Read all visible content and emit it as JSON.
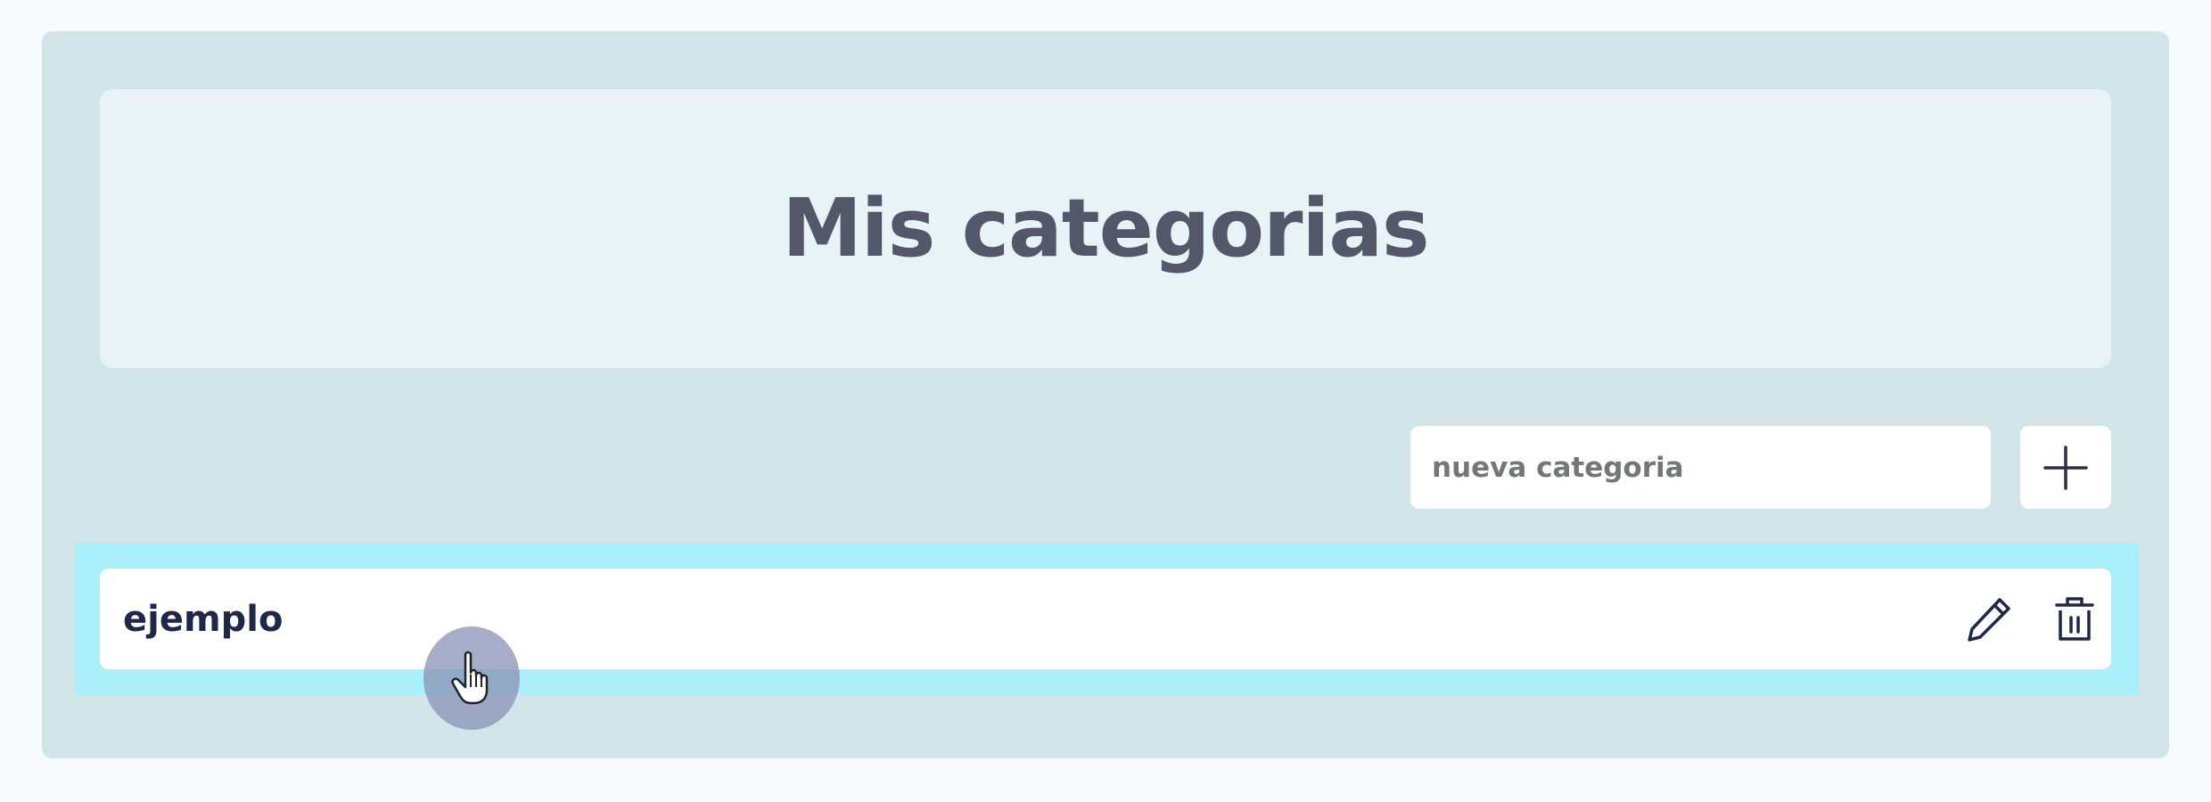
{
  "header": {
    "title": "Mis categorias"
  },
  "new_category": {
    "placeholder": "nueva categoria",
    "value": "",
    "add_icon": "plus-icon"
  },
  "categories": [
    {
      "name": "ejemplo",
      "edit_icon": "pencil-icon",
      "delete_icon": "trash-icon"
    }
  ],
  "cursor": {
    "icon": "hand-pointer-icon"
  },
  "colors": {
    "page_background": "#f7fbfc",
    "panel_background": "#d2e6ea",
    "header_background": "#e7f3f5",
    "row_highlight": "#a9f0fa",
    "title_text": "#535769",
    "item_text": "#1e2749",
    "icon_color": "#1e2749"
  }
}
